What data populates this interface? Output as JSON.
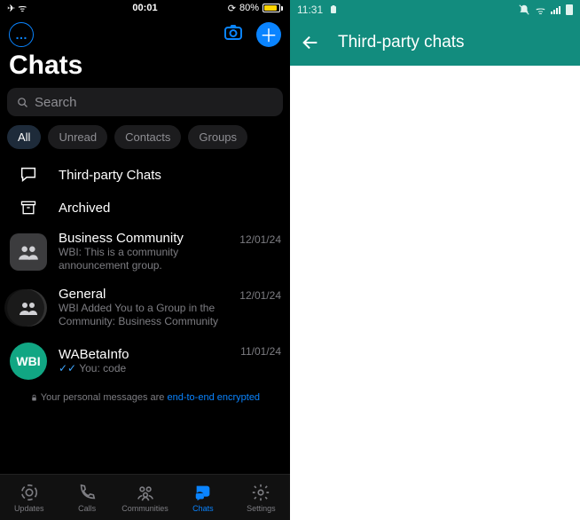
{
  "left": {
    "status": {
      "time": "00:01",
      "battery_pct": "80%"
    },
    "title": "Chats",
    "search_placeholder": "Search",
    "filters": [
      {
        "label": "All",
        "active": true
      },
      {
        "label": "Unread",
        "active": false
      },
      {
        "label": "Contacts",
        "active": false
      },
      {
        "label": "Groups",
        "active": false
      }
    ],
    "third_party_label": "Third-party Chats",
    "archived_label": "Archived",
    "chats": [
      {
        "name": "Business Community",
        "preview": "WBI: This is a community announcement group.",
        "date": "12/01/24",
        "avatar": "group-square"
      },
      {
        "name": "General",
        "preview": "WBI Added You to a Group in the Community: Business Community",
        "date": "12/01/24",
        "avatar": "group-stack"
      },
      {
        "name": "WABetaInfo",
        "preview": "You:  code",
        "date": "11/01/24",
        "avatar": "wbi",
        "read_receipt": true
      }
    ],
    "encryption": {
      "prefix": "Your personal messages are ",
      "link": "end-to-end encrypted"
    },
    "tabs": [
      {
        "label": "Updates",
        "icon": "status",
        "active": false
      },
      {
        "label": "Calls",
        "icon": "phone",
        "active": false
      },
      {
        "label": "Communities",
        "icon": "communities",
        "active": false
      },
      {
        "label": "Chats",
        "icon": "chats",
        "active": true
      },
      {
        "label": "Settings",
        "icon": "gear",
        "active": false
      }
    ]
  },
  "right": {
    "status": {
      "time": "11:31"
    },
    "header_title": "Third-party chats"
  }
}
